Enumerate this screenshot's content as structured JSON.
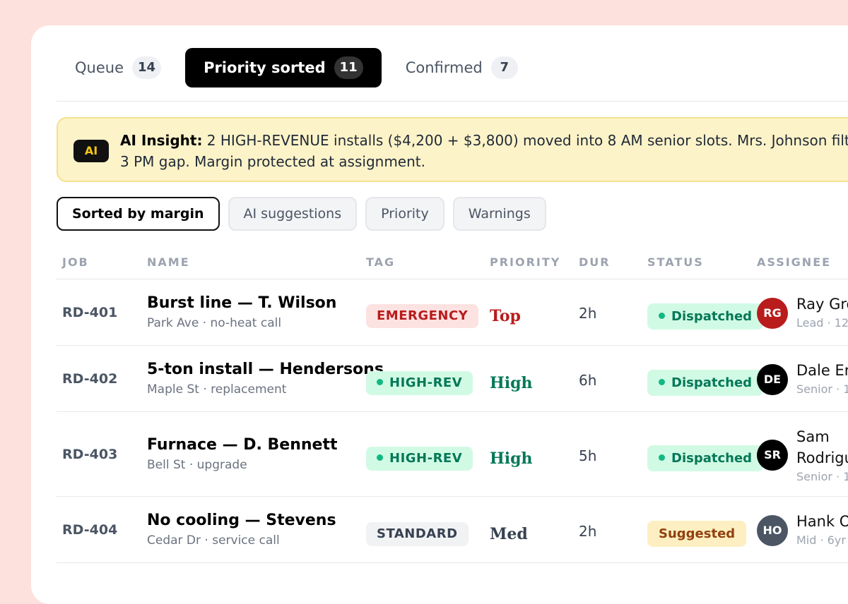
{
  "tabs": [
    {
      "label": "Queue",
      "count": "14",
      "active": false
    },
    {
      "label": "Priority sorted",
      "count": "11",
      "active": true
    },
    {
      "label": "Confirmed",
      "count": "7",
      "active": false
    }
  ],
  "insight": {
    "badge": "AI",
    "title": "AI Insight:",
    "text": "2 HIGH-REVENUE installs ($4,200 + $3,800) moved into 8 AM senior slots. Mrs. Johnson filte",
    "text2": "3 PM gap. Margin protected at assignment."
  },
  "filters": [
    "Sorted by margin",
    "AI suggestions",
    "Priority",
    "Warnings"
  ],
  "columns": [
    "JOB",
    "NAME",
    "TAG",
    "PRIORITY",
    "DUR",
    "STATUS",
    "ASSIGNEE"
  ],
  "rows": [
    {
      "job": "RD-401",
      "title": "Burst line — T. Wilson",
      "sub": "Park Ave · no-heat call",
      "tag": "EMERGENCY",
      "priority": "Top",
      "dur": "2h",
      "status": "Dispatched",
      "initials": "RG",
      "avatar_color": "#b91c1c",
      "assignee": "Ray Gre",
      "assignee2": "",
      "meta": "Lead · 12y"
    },
    {
      "job": "RD-402",
      "title": "5-ton install — Hendersons",
      "sub": "Maple St · replacement",
      "tag": "HIGH-REV",
      "priority": "High",
      "dur": "6h",
      "status": "Dispatched",
      "initials": "DE",
      "avatar_color": "#000000",
      "assignee": "Dale Eri",
      "assignee2": "",
      "meta": "Senior · 1"
    },
    {
      "job": "RD-403",
      "title": "Furnace — D. Bennett",
      "sub": "Bell St · upgrade",
      "tag": "HIGH-REV",
      "priority": "High",
      "dur": "5h",
      "status": "Dispatched",
      "initials": "SR",
      "avatar_color": "#000000",
      "assignee": "Sam",
      "assignee2": "Rodrigu",
      "meta": "Senior · 1"
    },
    {
      "job": "RD-404",
      "title": "No cooling — Stevens",
      "sub": "Cedar Dr · service call",
      "tag": "STANDARD",
      "priority": "Med",
      "dur": "2h",
      "status": "Suggested",
      "initials": "HO",
      "avatar_color": "#4b5563",
      "assignee": "Hank O",
      "assignee2": "",
      "meta": "Mid · 6yr"
    }
  ]
}
